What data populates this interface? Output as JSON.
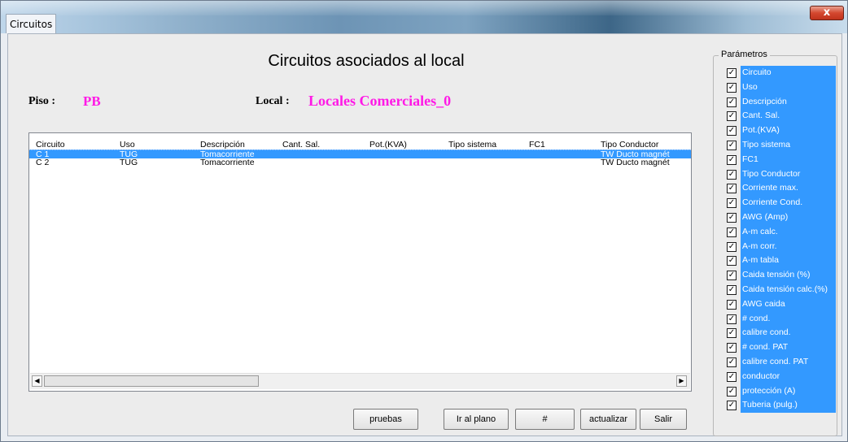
{
  "window": {
    "title": "Circuitos",
    "close_glyph": "x"
  },
  "header": {
    "heading": "Circuitos asociados al local",
    "piso_label": "Piso :",
    "piso_value": "PB",
    "local_label": "Local :",
    "local_value": "Locales Comerciales_0"
  },
  "list": {
    "columns": [
      "Circuito",
      "Uso",
      "Descripción",
      "Cant. Sal.",
      "Pot.(KVA)",
      "Tipo sistema",
      "FC1",
      "Tipo Conductor"
    ],
    "rows": [
      [
        "C 1",
        "TUG",
        "Tomacorriente",
        "",
        "",
        "",
        "",
        "TW Ducto magnét"
      ],
      [
        "C 2",
        "TUG",
        "Tomacorriente",
        "",
        "",
        "",
        "",
        "TW Ducto magnét"
      ]
    ],
    "scroll_left": "◀",
    "scroll_right": "▶"
  },
  "buttons": {
    "pruebas": "pruebas",
    "ir_al_plano": "Ir al plano",
    "hash": "#",
    "actualizar": "actualizar",
    "salir": "Salir"
  },
  "parameters": {
    "legend": "Parámetros",
    "checkmark": "✓",
    "items": [
      "Circuito",
      "Uso",
      "Descripción",
      "Cant. Sal.",
      "Pot.(KVA)",
      "Tipo sistema",
      "FC1",
      "Tipo Conductor",
      "Corriente max.",
      "Corriente Cond.",
      "AWG (Amp)",
      "A-m calc.",
      "A-m corr.",
      "A-m tabla",
      "Caida tensión (%)",
      "Caida tensión calc.(%)",
      "AWG caida",
      "# cond.",
      "calibre cond.",
      "# cond. PAT",
      "calibre cond. PAT",
      "conductor",
      "protección (A)",
      "Tuberia (pulg.)"
    ]
  }
}
